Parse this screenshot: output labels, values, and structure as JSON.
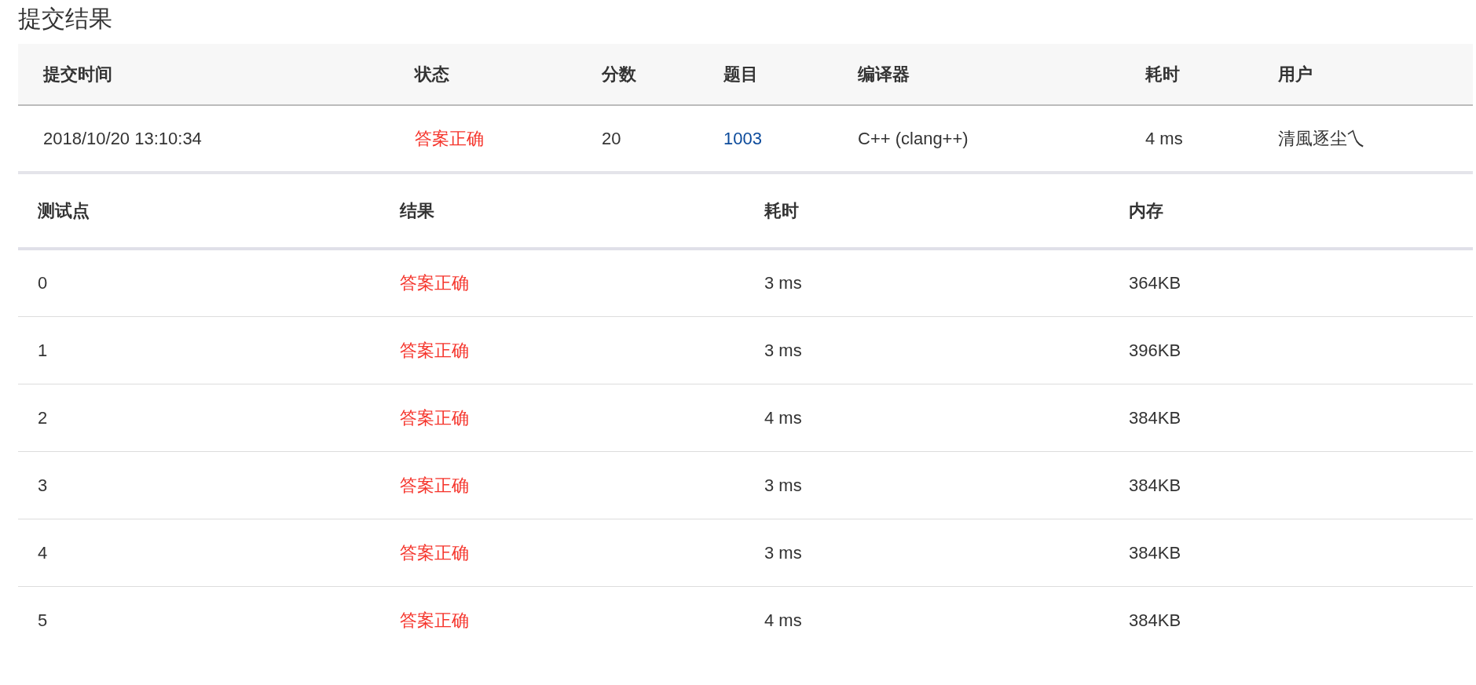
{
  "title": "提交结果",
  "submission": {
    "columns": [
      "提交时间",
      "状态",
      "分数",
      "题目",
      "编译器",
      "耗时",
      "用户"
    ],
    "row": {
      "time": "2018/10/20 13:10:34",
      "status": "答案正确",
      "score": "20",
      "problem": "1003",
      "compiler": "C++ (clang++)",
      "duration": "4 ms",
      "user": "清風逐尘乀"
    }
  },
  "tests": {
    "columns": [
      "测试点",
      "结果",
      "耗时",
      "内存"
    ],
    "rows": [
      {
        "case": "0",
        "result": "答案正确",
        "time": "3 ms",
        "memory": "364KB"
      },
      {
        "case": "1",
        "result": "答案正确",
        "time": "3 ms",
        "memory": "396KB"
      },
      {
        "case": "2",
        "result": "答案正确",
        "time": "4 ms",
        "memory": "384KB"
      },
      {
        "case": "3",
        "result": "答案正确",
        "time": "3 ms",
        "memory": "384KB"
      },
      {
        "case": "4",
        "result": "答案正确",
        "time": "3 ms",
        "memory": "384KB"
      },
      {
        "case": "5",
        "result": "答案正确",
        "time": "4 ms",
        "memory": "384KB"
      }
    ]
  }
}
